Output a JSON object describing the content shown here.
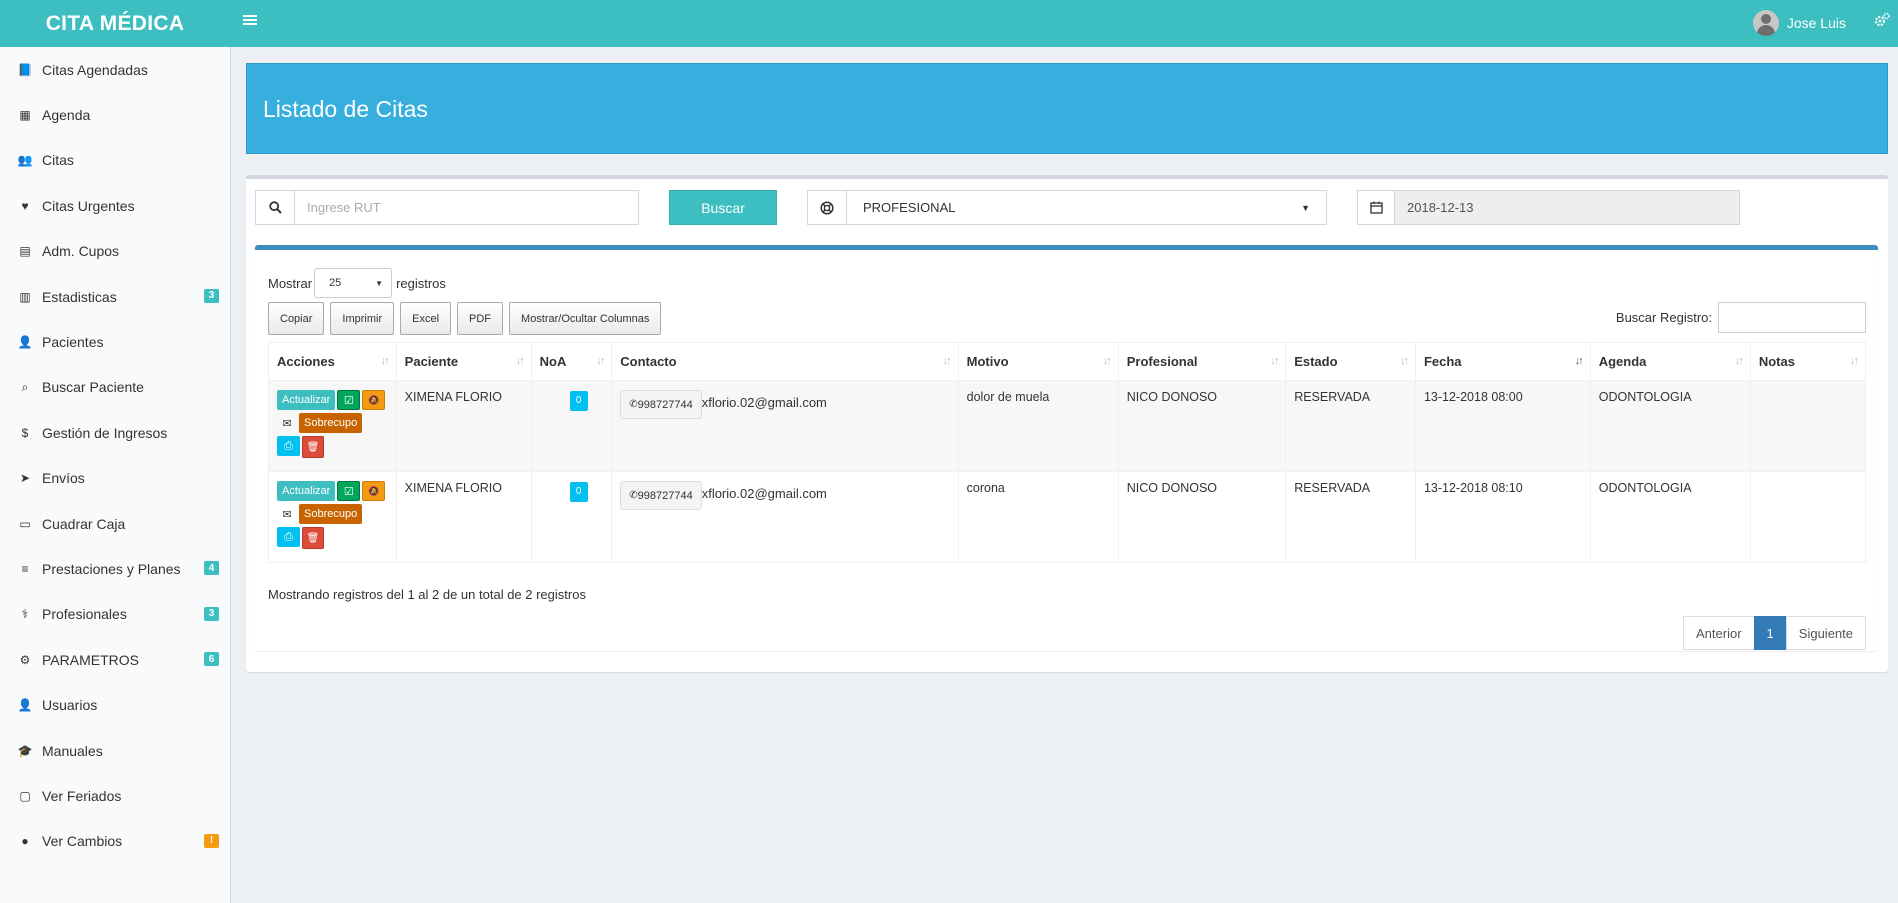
{
  "app": {
    "brand": "CITA MÉDICA",
    "user_name": "Jose Luis"
  },
  "colors": {
    "topbar": "#3dbfc1",
    "banner": "#36aede",
    "badge_teal": "#3dbfc1",
    "badge_warning": "#f39c12"
  },
  "sidebar": {
    "items": [
      {
        "label": "Citas Agendadas",
        "icon": "book-icon"
      },
      {
        "label": "Agenda",
        "icon": "calendar-icon"
      },
      {
        "label": "Citas",
        "icon": "users-icon"
      },
      {
        "label": "Citas Urgentes",
        "icon": "heartbeat-icon"
      },
      {
        "label": "Adm. Cupos",
        "icon": "list-alt-icon"
      },
      {
        "label": "Estadisticas",
        "icon": "bar-chart-icon",
        "badge": "3"
      },
      {
        "label": "Pacientes",
        "icon": "user-plus-icon"
      },
      {
        "label": "Buscar Paciente",
        "icon": "search-icon"
      },
      {
        "label": "Gestión de Ingresos",
        "icon": "dollar-icon"
      },
      {
        "label": "Envíos",
        "icon": "paper-plane-icon"
      },
      {
        "label": "Cuadrar Caja",
        "icon": "credit-card-icon"
      },
      {
        "label": "Prestaciones y Planes",
        "icon": "bars-icon",
        "badge": "4"
      },
      {
        "label": "Profesionales",
        "icon": "user-md-icon",
        "badge": "3"
      },
      {
        "label": "PARAMETROS",
        "icon": "cogs-icon",
        "badge": "6"
      },
      {
        "label": "Usuarios",
        "icon": "user-icon"
      },
      {
        "label": "Manuales",
        "icon": "graduation-cap-icon"
      },
      {
        "label": "Ver Feriados",
        "icon": "calendar-o-icon"
      },
      {
        "label": "Ver Cambios",
        "icon": "exclamation-circle-icon",
        "badge": "!"
      }
    ]
  },
  "page": {
    "title": "Listado de Citas"
  },
  "filters": {
    "rut_placeholder": "Ingrese RUT",
    "buscar_label": "Buscar",
    "profesional_value": "PROFESIONAL",
    "date_value": "2018-12-13"
  },
  "table_tools": {
    "mostrar_label": "Mostrar",
    "length_value": "25",
    "registros_label": "registros",
    "buttons": [
      "Copiar",
      "Imprimir",
      "Excel",
      "PDF",
      "Mostrar/Ocultar Columnas"
    ],
    "search_label": "Buscar Registro:"
  },
  "table": {
    "columns": [
      "Acciones",
      "Paciente",
      "NoA",
      "Contacto",
      "Motivo",
      "Profesional",
      "Estado",
      "Fecha",
      "Agenda",
      "Notas"
    ],
    "action_labels": {
      "update": "Actualizar",
      "overbook": "Sobrecupo"
    },
    "rows": [
      {
        "paciente": "XIMENA FLORIO",
        "noa": "0",
        "phone": "998727744",
        "email": "xflorio.02@gmail.com",
        "motivo": "dolor de muela",
        "profesional": "NICO DONOSO",
        "estado": "RESERVADA",
        "fecha": "13-12-2018 08:00",
        "agenda": "ODONTOLOGIA",
        "notas": ""
      },
      {
        "paciente": "XIMENA FLORIO",
        "noa": "0",
        "phone": "998727744",
        "email": "xflorio.02@gmail.com",
        "motivo": "corona",
        "profesional": "NICO DONOSO",
        "estado": "RESERVADA",
        "fecha": "13-12-2018 08:10",
        "agenda": "ODONTOLOGIA",
        "notas": ""
      }
    ],
    "info": "Mostrando registros del 1 al 2 de un total de 2 registros"
  },
  "pagination": {
    "prev": "Anterior",
    "current": "1",
    "next": "Siguiente"
  }
}
